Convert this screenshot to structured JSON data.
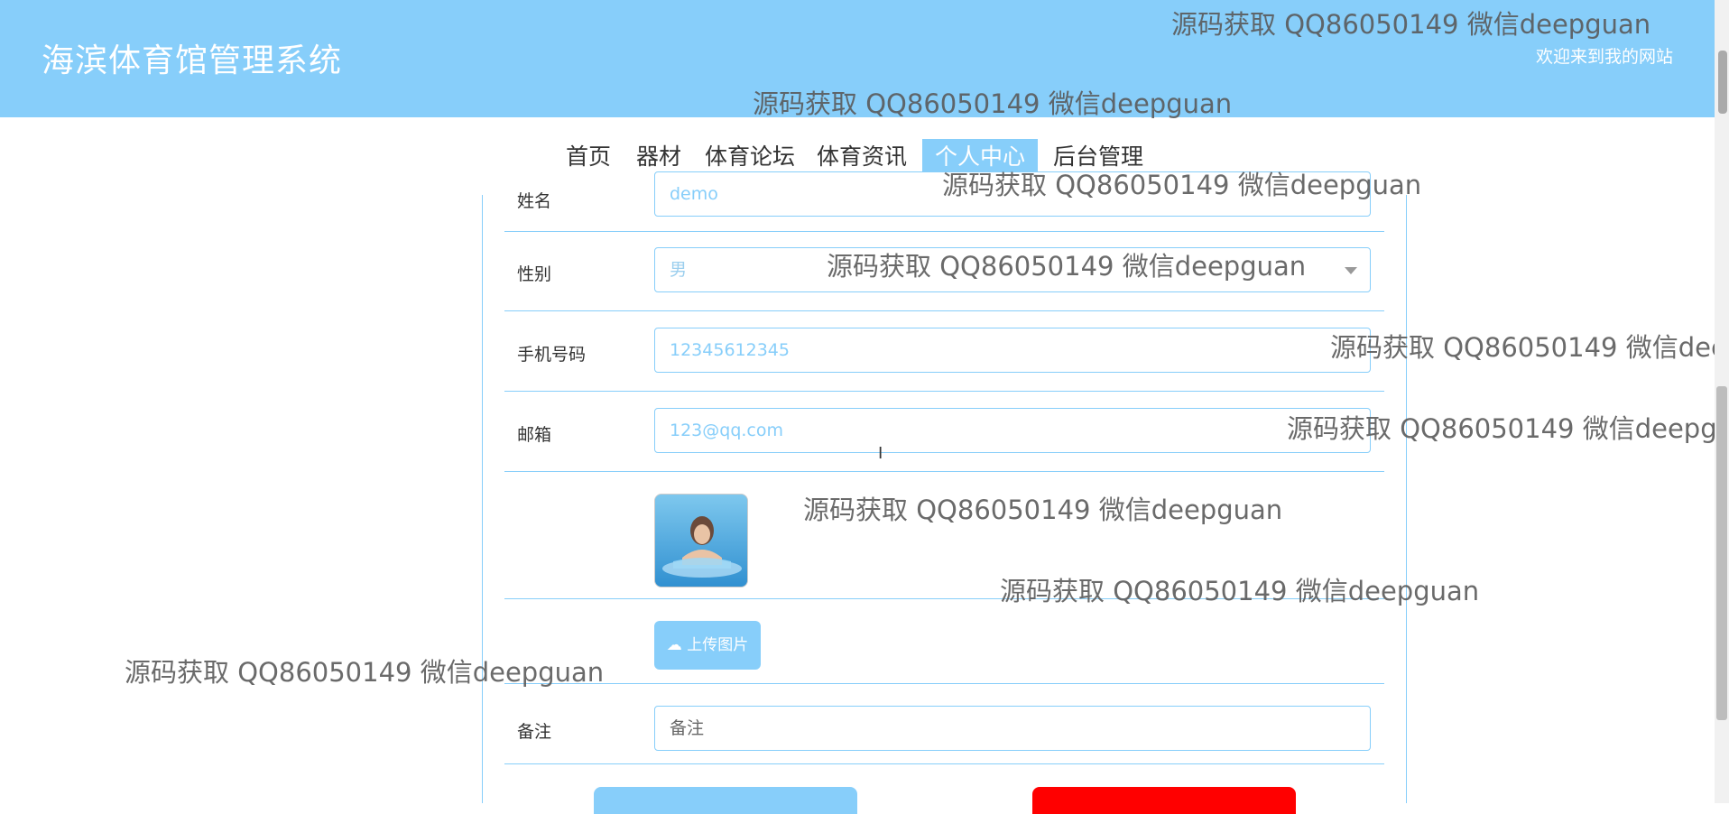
{
  "header": {
    "site_title": "海滨体育馆管理系统",
    "welcome": "欢迎来到我的网站"
  },
  "nav": {
    "items": [
      "首页",
      "器材",
      "体育论坛",
      "体育资讯",
      "个人中心",
      "后台管理"
    ],
    "active": "个人中心"
  },
  "form": {
    "name": {
      "label": "姓名",
      "value": "demo"
    },
    "gender": {
      "label": "性别",
      "value": "男"
    },
    "phone": {
      "label": "手机号码",
      "value": "12345612345"
    },
    "email": {
      "label": "邮箱",
      "value": "123@qq.com"
    },
    "upload_label": "上传图片",
    "remark": {
      "label": "备注",
      "placeholder": "备注"
    }
  },
  "watermark_text": "源码获取 QQ86050149 微信deepguan",
  "colors": {
    "accent": "#87CEFA",
    "danger": "#FF0000"
  }
}
